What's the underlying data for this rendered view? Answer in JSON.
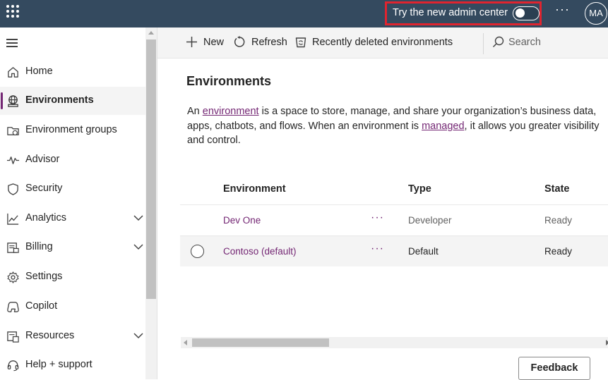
{
  "topbar": {
    "try_label": "Try the new admin center",
    "toggle_on": false,
    "more_label": "···",
    "avatar_initials": "MA",
    "accent": "#344a5f",
    "highlight": "#e0242f"
  },
  "sidebar": {
    "items": [
      {
        "label": "Home",
        "icon": "home-icon"
      },
      {
        "label": "Environments",
        "icon": "globe-icon",
        "active": true
      },
      {
        "label": "Environment groups",
        "icon": "folder-globe-icon"
      },
      {
        "label": "Advisor",
        "icon": "pulse-icon"
      },
      {
        "label": "Security",
        "icon": "shield-icon"
      },
      {
        "label": "Analytics",
        "icon": "chart-line-icon",
        "expandable": true
      },
      {
        "label": "Billing",
        "icon": "billing-icon",
        "expandable": true
      },
      {
        "label": "Settings",
        "icon": "gear-icon"
      },
      {
        "label": "Copilot",
        "icon": "copilot-icon"
      },
      {
        "label": "Resources",
        "icon": "resources-icon",
        "expandable": true
      },
      {
        "label": "Help + support",
        "icon": "headset-icon"
      }
    ]
  },
  "cmdbar": {
    "new_label": "New",
    "refresh_label": "Refresh",
    "deleted_label": "Recently deleted environments",
    "search_placeholder": "Search"
  },
  "main": {
    "title": "Environments",
    "desc_1": "An ",
    "desc_link_1": "environment",
    "desc_2": " is a space to store, manage, and share your organization’s business data, apps, chatbots, and flows. When an environment is ",
    "desc_link_2": "managed",
    "desc_3": ", it allows you greater visibility and control.",
    "table": {
      "columns": [
        "Environment",
        "Type",
        "State"
      ],
      "rows": [
        {
          "name": "Dev One",
          "more": "···",
          "type": "Developer",
          "state": "Ready",
          "selected": false
        },
        {
          "name": "Contoso (default)",
          "more": "···",
          "type": "Default",
          "state": "Ready",
          "selected": true
        }
      ]
    },
    "feedback_label": "Feedback",
    "link_color": "#742774"
  }
}
